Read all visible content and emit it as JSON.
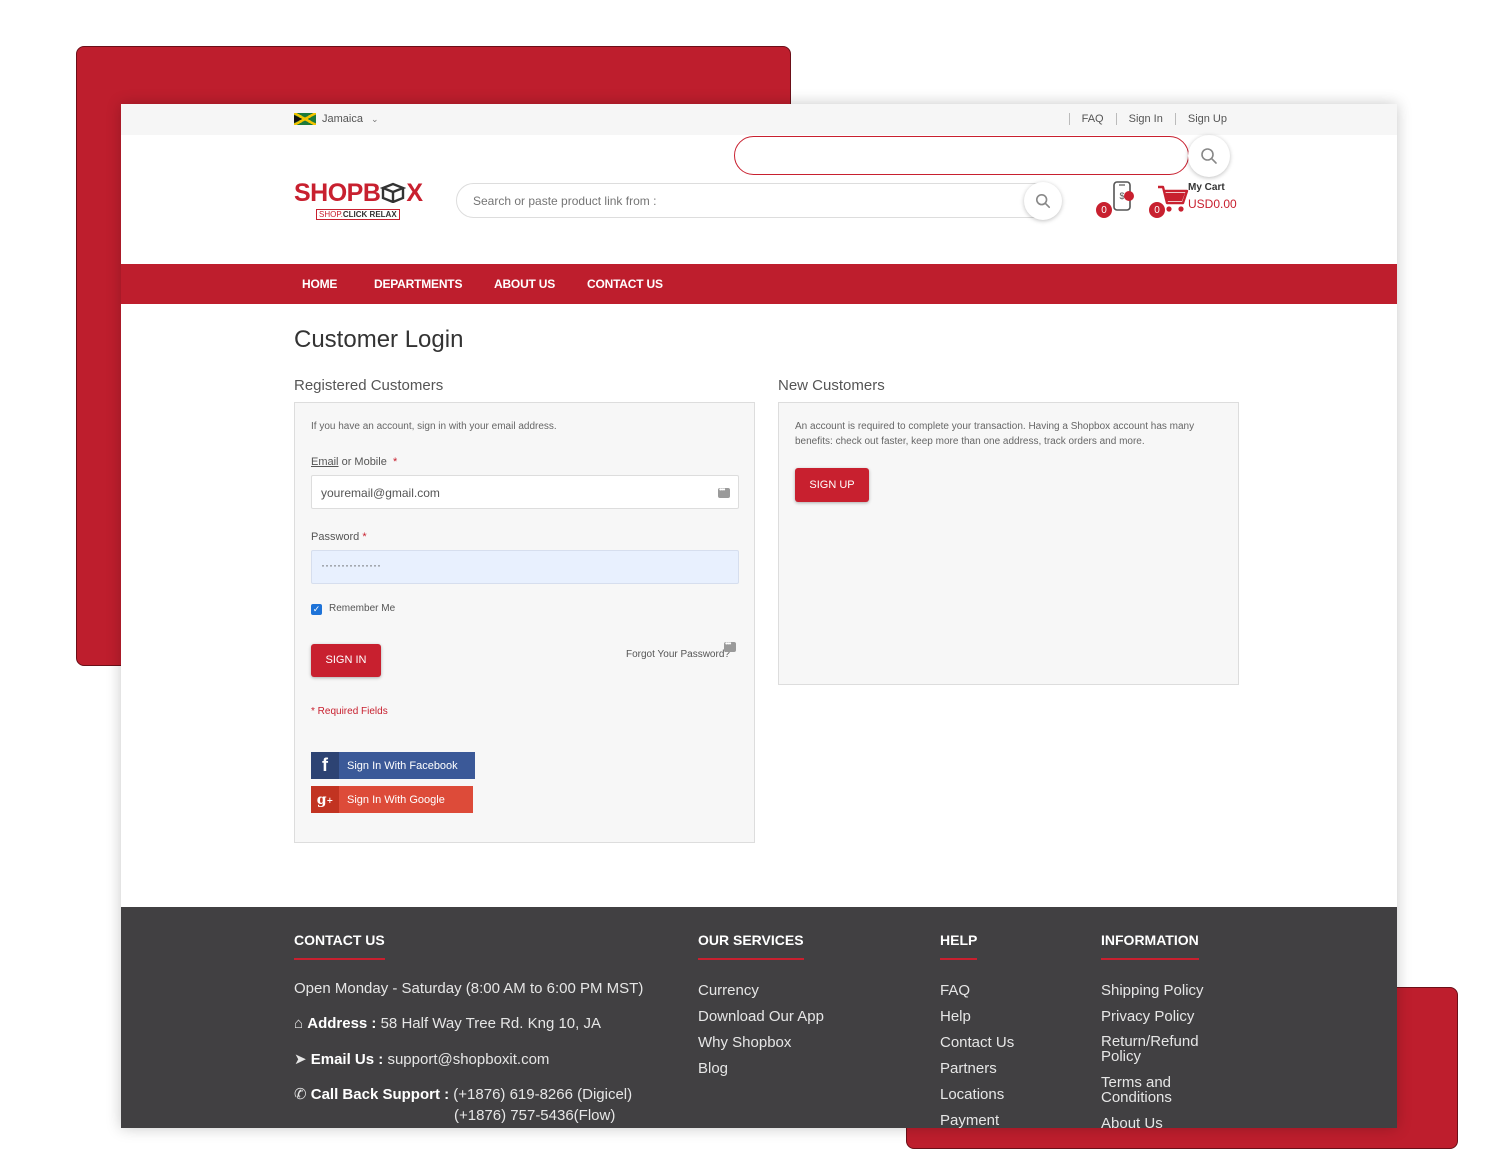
{
  "topbar": {
    "country": "Jamaica",
    "links": [
      "FAQ",
      "Sign In",
      "Sign Up"
    ]
  },
  "header": {
    "logo_text": "SHOPB",
    "logo_text_end": "X",
    "tagline_a": "SHOP.",
    "tagline_b": "CLICK RELAX",
    "search_placeholder": "Search or paste product link from :",
    "app_badge": "0",
    "cart_badge": "0",
    "cart_label": "My Cart",
    "cart_total": "USD0.00"
  },
  "nav": [
    "HOME",
    "DEPARTMENTS",
    "ABOUT US",
    "CONTACT US"
  ],
  "page_title": "Customer Login",
  "registered": {
    "title": "Registered Customers",
    "intro": "If you have an account, sign in with your email address.",
    "email_label": "Email",
    "email_label_rest": " or Mobile",
    "required_mark": "*",
    "email_value": "youremail@gmail.com",
    "password_label": "Password",
    "password_value": "···············",
    "remember": "Remember Me",
    "signin": "SIGN IN",
    "forgot": "Forgot Your Password?",
    "required_fields": "* Required Fields",
    "facebook": "Sign In With Facebook",
    "google": "Sign In With Google"
  },
  "new_customers": {
    "title": "New Customers",
    "text": "An account is required to complete your transaction. Having a Shopbox account has many benefits: check out faster, keep more than one address, track orders and more.",
    "signup": "SIGN UP"
  },
  "footer": {
    "contact": {
      "heading": "CONTACT US",
      "hours": "Open Monday - Saturday (8:00 AM to 6:00 PM MST)",
      "address_label": "Address :",
      "address": "58 Half Way Tree Rd. Kng 10, JA",
      "email_label": "Email Us :",
      "email": "support@shopboxit.com",
      "callback_label": "Call Back Support :",
      "phone1": "(+1876) 619-8266 (Digicel)",
      "phone2": "(+1876) 757-5436(Flow)"
    },
    "services": {
      "heading": "OUR SERVICES",
      "items": [
        "Currency",
        "Download Our App",
        "Why Shopbox",
        "Blog"
      ]
    },
    "help": {
      "heading": "HELP",
      "items": [
        "FAQ",
        "Help",
        "Contact Us",
        "Partners",
        "Locations",
        "Payment"
      ]
    },
    "information": {
      "heading": "INFORMATION",
      "items": [
        "Shipping Policy",
        "Privacy Policy",
        "Return/Refund",
        "Policy",
        "Terms and",
        "Conditions",
        "About Us"
      ]
    }
  }
}
